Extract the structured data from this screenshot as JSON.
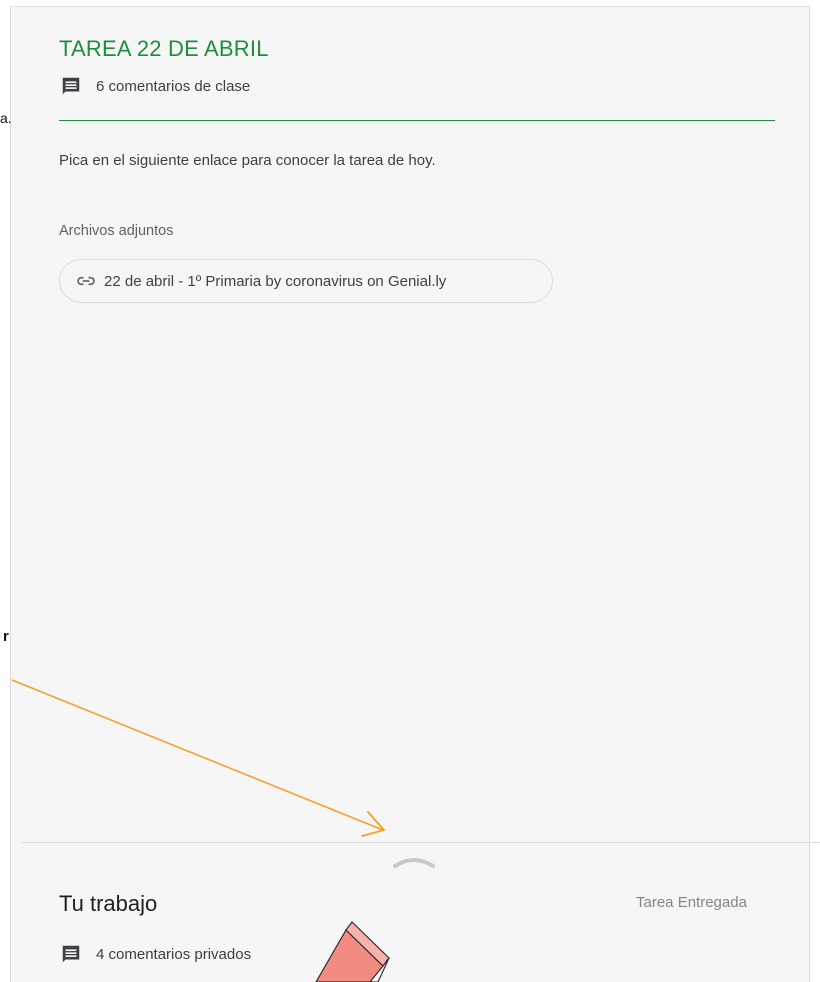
{
  "margin": {
    "fragment_a": "a.",
    "fragment_r": "r"
  },
  "assignment": {
    "title": "TAREA 22 DE ABRIL",
    "class_comments": "6 comentarios de clase",
    "description": "Pica en el siguiente enlace para conocer la tarea de hoy.",
    "attachments_label": "Archivos adjuntos",
    "attachment_link": "22 de abril - 1º Primaria by coronavirus on Genial.ly"
  },
  "your_work": {
    "title": "Tu trabajo",
    "status": "Tarea Entregada",
    "private_comments": "4 comentarios privados"
  },
  "colors": {
    "accent": "#1e8e3e",
    "annotation_arrow": "#f5a12a",
    "annotation_marker": "#f28b82"
  },
  "icons": [
    "comment-icon",
    "link-icon",
    "chevron-up-icon",
    "arrow-annotation",
    "marker-annotation"
  ]
}
